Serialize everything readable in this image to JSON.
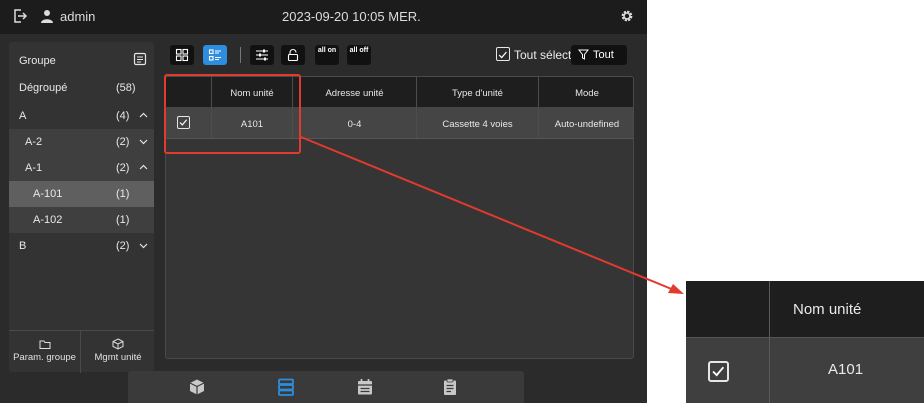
{
  "topbar": {
    "username": "admin",
    "datetime": "2023-09-20 10:05 MER."
  },
  "sidebar": {
    "header": "Groupe",
    "rows": [
      {
        "name": "Dégroupé",
        "count": "(58)"
      },
      {
        "name": "A",
        "count": "(4)",
        "chevron": "up"
      },
      {
        "name": "A-2",
        "count": "(2)",
        "chevron": "down"
      },
      {
        "name": "A-1",
        "count": "(2)",
        "chevron": "up"
      },
      {
        "name": "A-101",
        "count": "(1)"
      },
      {
        "name": "A-102",
        "count": "(1)"
      },
      {
        "name": "B",
        "count": "(2)",
        "chevron": "down"
      }
    ],
    "selected": "A-101",
    "param_label": "Param. groupe",
    "mgmt_label": "Mgmt unité"
  },
  "toolbar": {
    "all_on": "all on",
    "all_off": "all off",
    "select_all_label": "Tout sélect",
    "select_all_checked": true,
    "filter_label": "Tout"
  },
  "table": {
    "headers": [
      "",
      "Nom unité",
      "Adresse unité",
      "Type d'unité",
      "Mode"
    ],
    "rows": [
      {
        "checked": true,
        "name": "A101",
        "address": "0-4",
        "type": "Cassette 4 voies",
        "mode": "Auto-undefined"
      }
    ]
  },
  "bottomnav": {
    "items": [
      "unit-icon",
      "list-icon",
      "calendar-icon",
      "clipboard-icon"
    ],
    "active": "list-icon"
  },
  "zoom": {
    "header": "Nom unité",
    "value": "A101",
    "checked": true
  },
  "colors": {
    "accent": "#2d8ee0",
    "annotation": "#e23a2e"
  }
}
